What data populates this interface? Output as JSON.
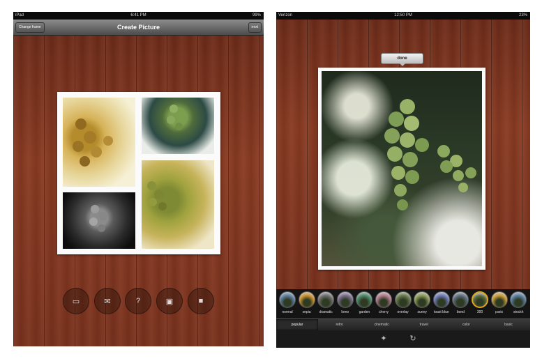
{
  "left": {
    "status": {
      "device": "iPad",
      "time": "6:41 PM",
      "battery": "99%"
    },
    "nav": {
      "title": "Create Picture",
      "left_button": "Change frame",
      "right_button": "next"
    },
    "actions": [
      {
        "name": "gallery-button",
        "icon": "picture-icon",
        "glyph": "▭"
      },
      {
        "name": "mail-button",
        "icon": "mail-icon",
        "glyph": "✉"
      },
      {
        "name": "help-button",
        "icon": "help-icon",
        "glyph": "?"
      },
      {
        "name": "crop-button",
        "icon": "crop-icon",
        "glyph": "▣"
      },
      {
        "name": "stop-button",
        "icon": "stop-icon",
        "glyph": "■"
      }
    ]
  },
  "right": {
    "status": {
      "carrier": "Verizon",
      "time": "12:50 PM",
      "battery": "23%"
    },
    "done_label": "done",
    "filters": [
      "normal",
      "sepia",
      "dramatic",
      "lomo",
      "garden",
      "cherry",
      "overlay",
      "sunny",
      "toast blue",
      "bond",
      "300",
      "paris",
      "stockh"
    ],
    "selected_filter": "300",
    "categories": [
      "popular",
      "retro",
      "cinematic",
      "travel",
      "color",
      "basic"
    ],
    "active_category": "popular",
    "tools": [
      {
        "name": "magic-wand-icon",
        "glyph": "✦"
      },
      {
        "name": "rotate-icon",
        "glyph": "↻"
      }
    ]
  },
  "colors": {
    "wood": "#7d341e",
    "accent": "#e0a51e"
  }
}
